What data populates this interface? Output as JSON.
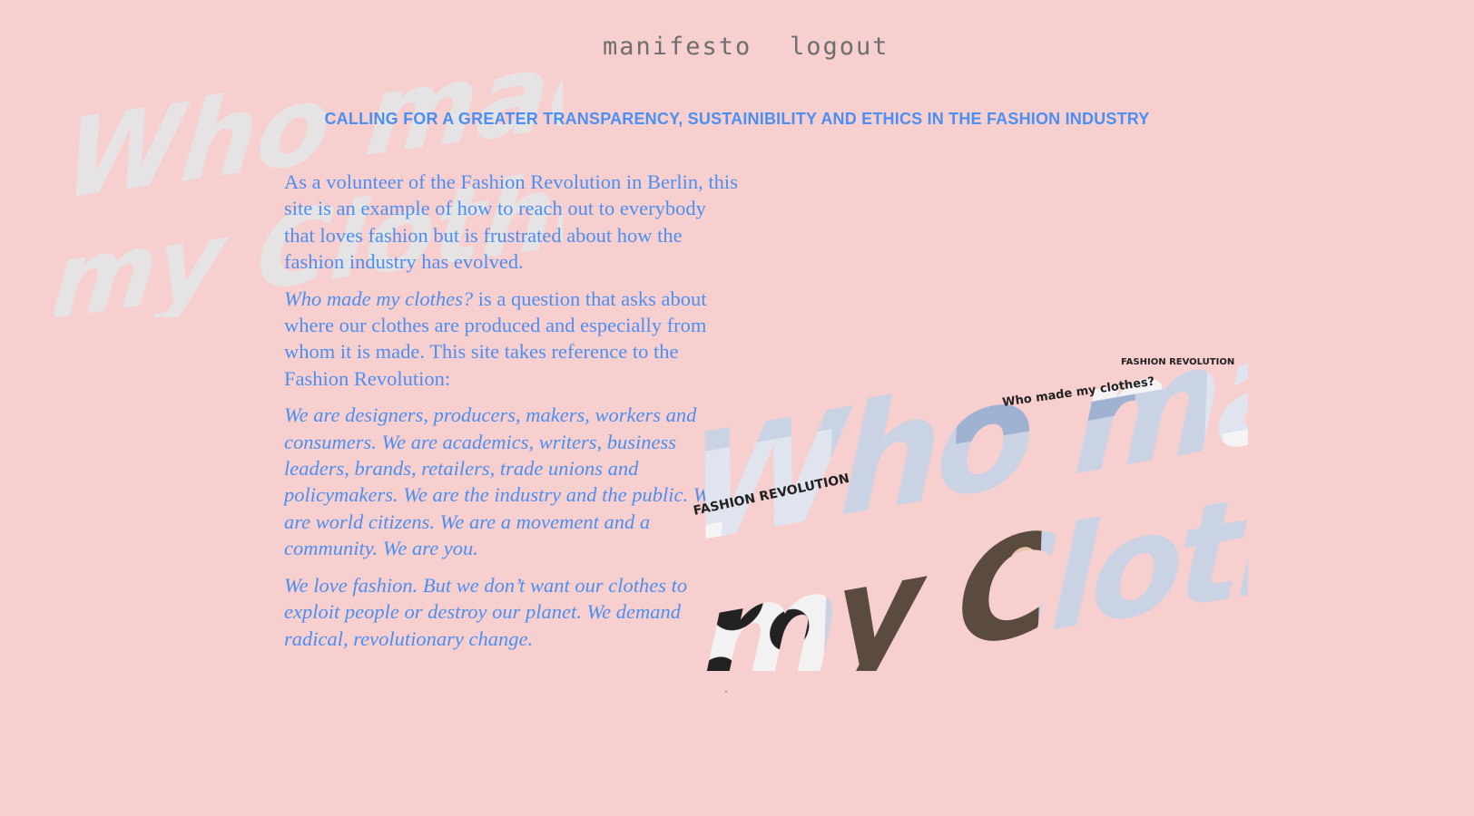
{
  "nav": {
    "manifesto": "manifesto",
    "logout": "logout"
  },
  "tagline": "CALLING FOR A GREATER TRANSPARENCY, SUSTAINIBILITY AND ETHICS IN THE FASHION INDUSTRY",
  "content": {
    "intro": "As a volunteer of the Fashion Revolution in Berlin, this site is an example of how to reach out to everybody that loves fashion but is frustrated about how the fashion industry has evolved.",
    "question_title": "Who made my clothes?",
    "question_rest": " is a question that asks about where our clothes are produced and especially from whom it is made. This site takes reference to the Fashion Revolution:",
    "quote_1": "We are designers, producers, makers, workers and consumers. We are academics, writers, business leaders, brands, retailers, trade unions and policymakers. We are the industry and the public. We are world citizens. We are a movement and a community. We are you.",
    "quote_2": "We love fashion. But we don’t want our clothes to exploit people or destroy our planet. We demand radical, revolutionary change."
  },
  "bg_logo": {
    "line1": "Who made",
    "line2": "my Clothes?"
  },
  "hero": {
    "line1": "Who made?",
    "line2": "my Clothes?",
    "badge_1": "FASHION REVOLUTION",
    "badge_2": "FASHION REVOLUTION",
    "sign": "Who made my clothes?"
  },
  "colors": {
    "background": "#f8cfcf",
    "accent": "#4b8ff0",
    "nav_text": "#6e6e6e",
    "watermark": "#e6e3e4"
  }
}
